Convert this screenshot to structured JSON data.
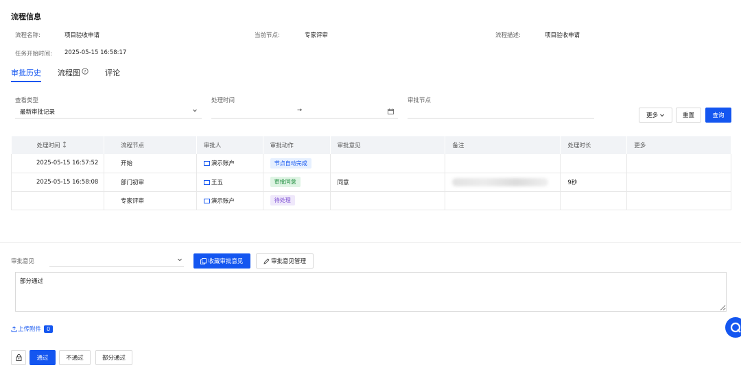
{
  "process_info": {
    "title": "流程信息",
    "name_label": "流程名称:",
    "name_value": "项目验收申请",
    "node_label": "当前节点:",
    "node_value": "专家评审",
    "desc_label": "流程描述:",
    "desc_value": "项目验收申请",
    "start_label": "任务开始时间:",
    "start_value": "2025-05-15 16:58:17"
  },
  "tabs": [
    {
      "label": "审批历史"
    },
    {
      "label": "流程图"
    },
    {
      "label": "评论"
    }
  ],
  "filters": {
    "type_label": "查看类型",
    "type_value": "最新审批记录",
    "time_label": "处理时间",
    "time_separator": "→",
    "node_label": "审批节点",
    "more_label": "更多",
    "reset_label": "重置",
    "query_label": "查询"
  },
  "table": {
    "headers": [
      "处理时间",
      "流程节点",
      "审批人",
      "审批动作",
      "审批意见",
      "备注",
      "处理时长",
      "更多"
    ],
    "rows": [
      {
        "time": "2025-05-15 16:57:52",
        "node": "开始",
        "approver": "演示账户",
        "action": "节点自动完成",
        "opinion": "",
        "duration": ""
      },
      {
        "time": "2025-05-15 16:58:08",
        "node": "部门初审",
        "approver": "王五",
        "action": "审批同意",
        "opinion": "同意",
        "duration": "9秒"
      },
      {
        "time": "",
        "node": "专家评审",
        "approver": "演示账户",
        "action": "待处理",
        "opinion": "",
        "duration": ""
      }
    ]
  },
  "opinion": {
    "label": "审批意见",
    "collect_label": "收藏审批意见",
    "manage_label": "审批意见管理",
    "text": "部分通过"
  },
  "upload": {
    "label": "上传附件",
    "count": "0"
  },
  "actions": {
    "pass_label": "通过",
    "reject_label": "不通过",
    "partial_label": "部分通过"
  },
  "colors": {
    "primary": "#1456f0"
  }
}
